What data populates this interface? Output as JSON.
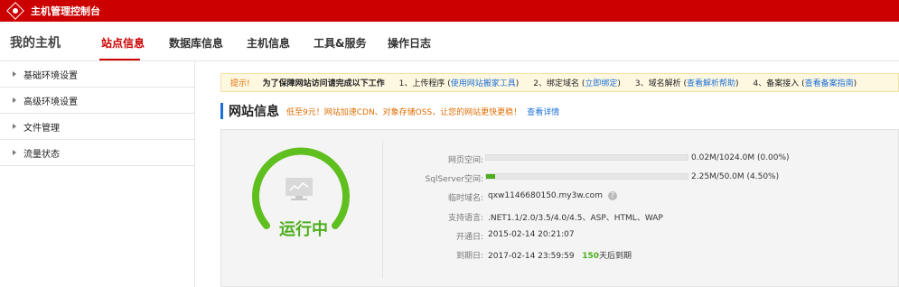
{
  "topbar": {
    "title": "主机管理控制台"
  },
  "nav": {
    "my_host": "我的主机",
    "tabs": [
      "站点信息",
      "数据库信息",
      "主机信息",
      "工具&服务",
      "操作日志"
    ],
    "active_index": 0
  },
  "sidebar": {
    "items": [
      "基础环境设置",
      "高级环境设置",
      "文件管理",
      "流量状态"
    ]
  },
  "notice": {
    "tip": "提示!",
    "intro": "为了保障网站访问请完成以下工作",
    "steps": [
      {
        "text": "1、上传程序",
        "link": "使用网站搬家工具"
      },
      {
        "text": "2、绑定域名",
        "link": "立即绑定"
      },
      {
        "text": "3、域名解析",
        "link": "查看解析帮助"
      },
      {
        "text": "4、备案接入",
        "link": "查看备案指南"
      }
    ]
  },
  "section": {
    "title": "网站信息",
    "promo": "低至9元！网站加速CDN、对象存储OSS，让您的网站更快更稳！",
    "more_link": "查看详情"
  },
  "status": {
    "label": "运行中",
    "color": "#4cae1c"
  },
  "info": {
    "web_space": {
      "label": "网页空间:",
      "value": "0.02M/1024.0M (0.00%)",
      "percent": 0.0
    },
    "sql_space": {
      "label": "SqlServer空间:",
      "value": "2.25M/50.0M (4.50%)",
      "percent": 4.5
    },
    "temp_domain": {
      "label": "临时域名:",
      "value": "qxw1146680150.my3w.com"
    },
    "languages": {
      "label": "支持语言:",
      "value": ".NET1.1/2.0/3.5/4.0/4.5、ASP、HTML、WAP"
    },
    "open_date": {
      "label": "开通日:",
      "value": "2015-02-14 20:21:07"
    },
    "expire_date": {
      "label": "到期日:",
      "value": "2017-02-14 23:59:59",
      "days": "150",
      "days_suffix": "天后到期"
    }
  },
  "colors": {
    "brand": "#cc0000",
    "link": "#1a6fd8",
    "accent": "#e06c00",
    "ok": "#4cae1c"
  },
  "icons": {
    "logo": "brand-logo-icon",
    "status": "server-chart-icon",
    "help": "question-circle-icon"
  }
}
